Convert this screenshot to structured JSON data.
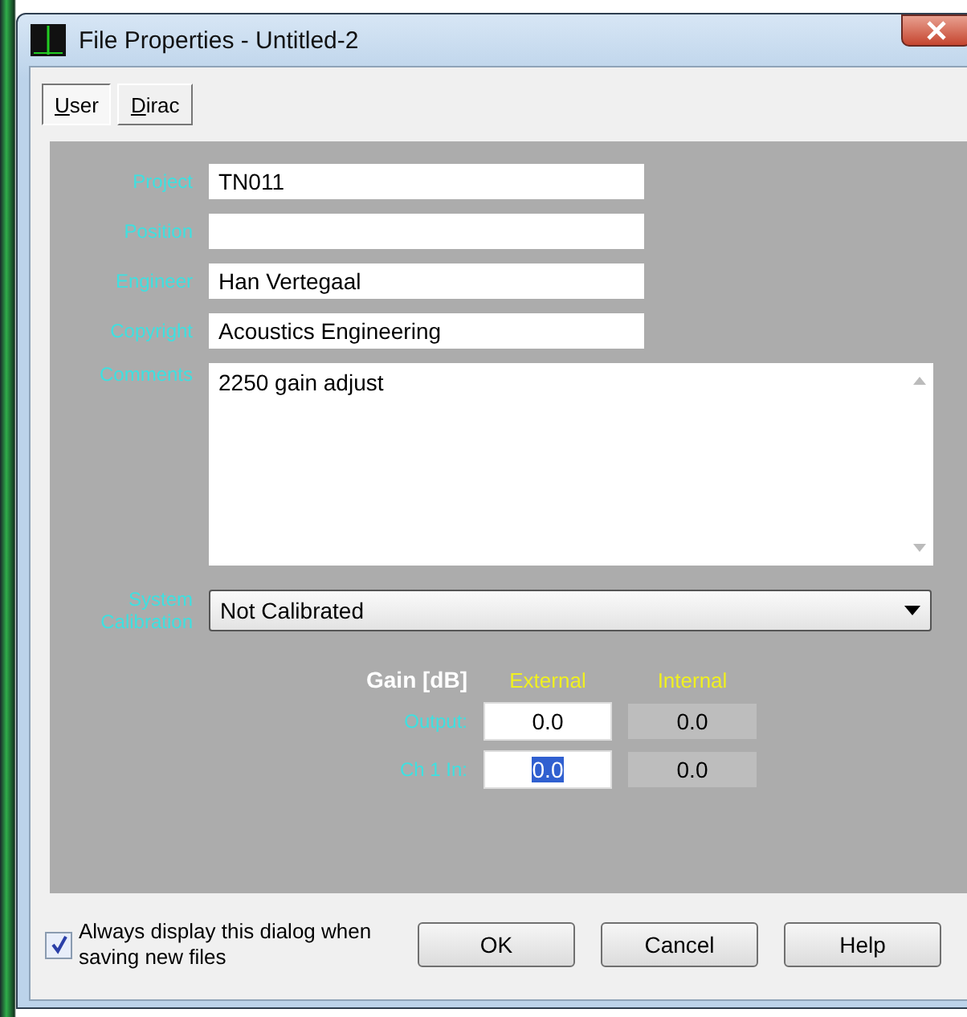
{
  "window": {
    "title": "File Properties - Untitled-2"
  },
  "tabs": [
    {
      "label": "User",
      "selected": true
    },
    {
      "label": "Dirac",
      "selected": false
    }
  ],
  "fields": [
    {
      "label": "Project",
      "value": "TN011"
    },
    {
      "label": "Position"
    },
    {
      "label": "Engineer",
      "value": "Han Vertegaal"
    },
    {
      "label": "Copyright",
      "value": "Acoustics Engineering"
    }
  ],
  "comments": {
    "label": "Comments",
    "value": "2250 gain adjust"
  },
  "calibration": {
    "label": "System Calibration",
    "value": "Not Calibrated"
  },
  "gain": {
    "title": "Gain [dB]",
    "columns": [
      "External",
      "Internal"
    ],
    "rows": [
      {
        "label": "Output:",
        "external": "0.0",
        "internal": "0.0",
        "selected": false
      },
      {
        "label": "Ch 1 In:",
        "external": "0.0",
        "internal": "0.0",
        "selected": true
      }
    ]
  },
  "always_display": {
    "label": "Always display this dialog when saving new files",
    "checked": true
  },
  "buttons": [
    "OK",
    "Cancel",
    "Help"
  ]
}
